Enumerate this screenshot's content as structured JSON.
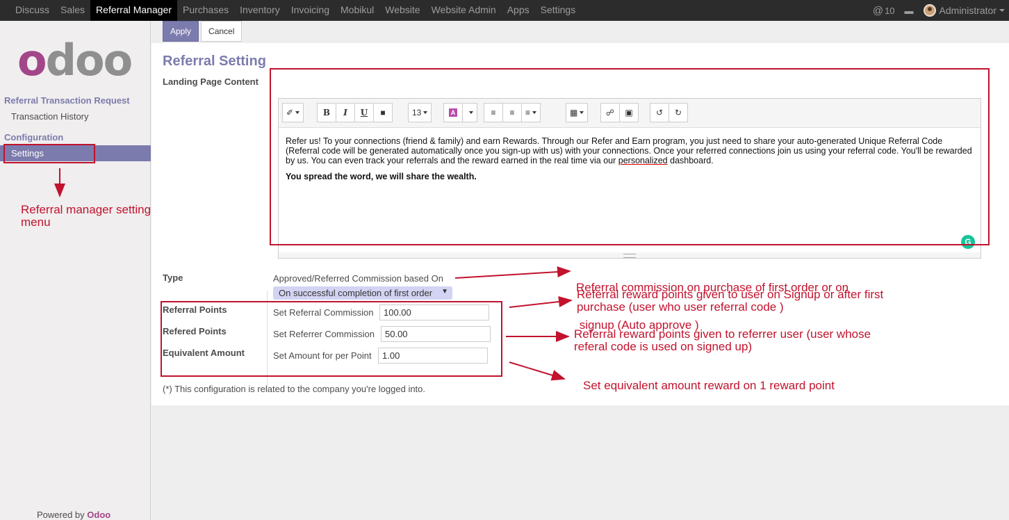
{
  "topbar": {
    "menu": [
      "Discuss",
      "Sales",
      "Referral Manager",
      "Purchases",
      "Inventory",
      "Invoicing",
      "Mobikul",
      "Website",
      "Website Admin",
      "Apps",
      "Settings"
    ],
    "active": "Referral Manager",
    "notifications": "10",
    "user": "Administrator"
  },
  "sidebar": {
    "logo": "odoo",
    "heading1": "Referral Transaction Request",
    "item1": "Transaction History",
    "heading2": "Configuration",
    "active_item": "Settings",
    "powered_prefix": "Powered by",
    "powered_brand": "Odoo"
  },
  "buttons": {
    "apply": "Apply",
    "cancel": "Cancel"
  },
  "form": {
    "title": "Referral Setting",
    "landing_label": "Landing Page Content",
    "font_size": "13",
    "content_p1_a": "Refer us! To your connections (friend & family) and earn Rewards. Through our Refer and Earn program, you just need to share your auto-generated Unique Referral Code (Referral code will be generated automatically once you sign-up with us) with your connections. Once your referred connections join us using your referral code. You'll be rewarded by us. You can even track your referrals and the reward earned in the real time via our ",
    "content_p1_link": "personalized",
    "content_p1_b": " dashboard.",
    "content_p2": "You spread the word, we will share the wealth.",
    "type_label": "Type",
    "type_desc": "Approved/Referred Commission based On",
    "type_value": "On successful completion of first order",
    "referral_points_label": "Referral Points",
    "refered_points_label": "Refered Points",
    "equivalent_amount_label": "Equivalent Amount",
    "referral_commission_label": "Set Referral Commission",
    "referral_commission_value": "100.00",
    "referrer_commission_label": "Set Referrer Commission",
    "referrer_commission_value": "50.00",
    "amount_per_point_label": "Set Amount for per Point",
    "amount_per_point_value": "1.00",
    "note": "(*) This configuration is related to the company you're logged into."
  },
  "annotations": {
    "menu_note_1": "Referral manager setting",
    "menu_note_2": "menu",
    "type_note_1": "Referral commission on purchase of first order or on",
    "type_note_2": " signup (Auto approve )",
    "referral_note_1": "Referral reward points given to user on Signup or after first",
    "referral_note_2": "purchase (user who user referral code )",
    "referrer_note_1": "Referral reward points given to referrer user (user whose",
    "referrer_note_2": "referal code is used on signed up)",
    "amount_note": "Set equivalent amount reward on 1 reward point"
  },
  "colors": {
    "accent": "#7c7bad",
    "brand": "#a24689",
    "annotation": "#c2122d"
  }
}
